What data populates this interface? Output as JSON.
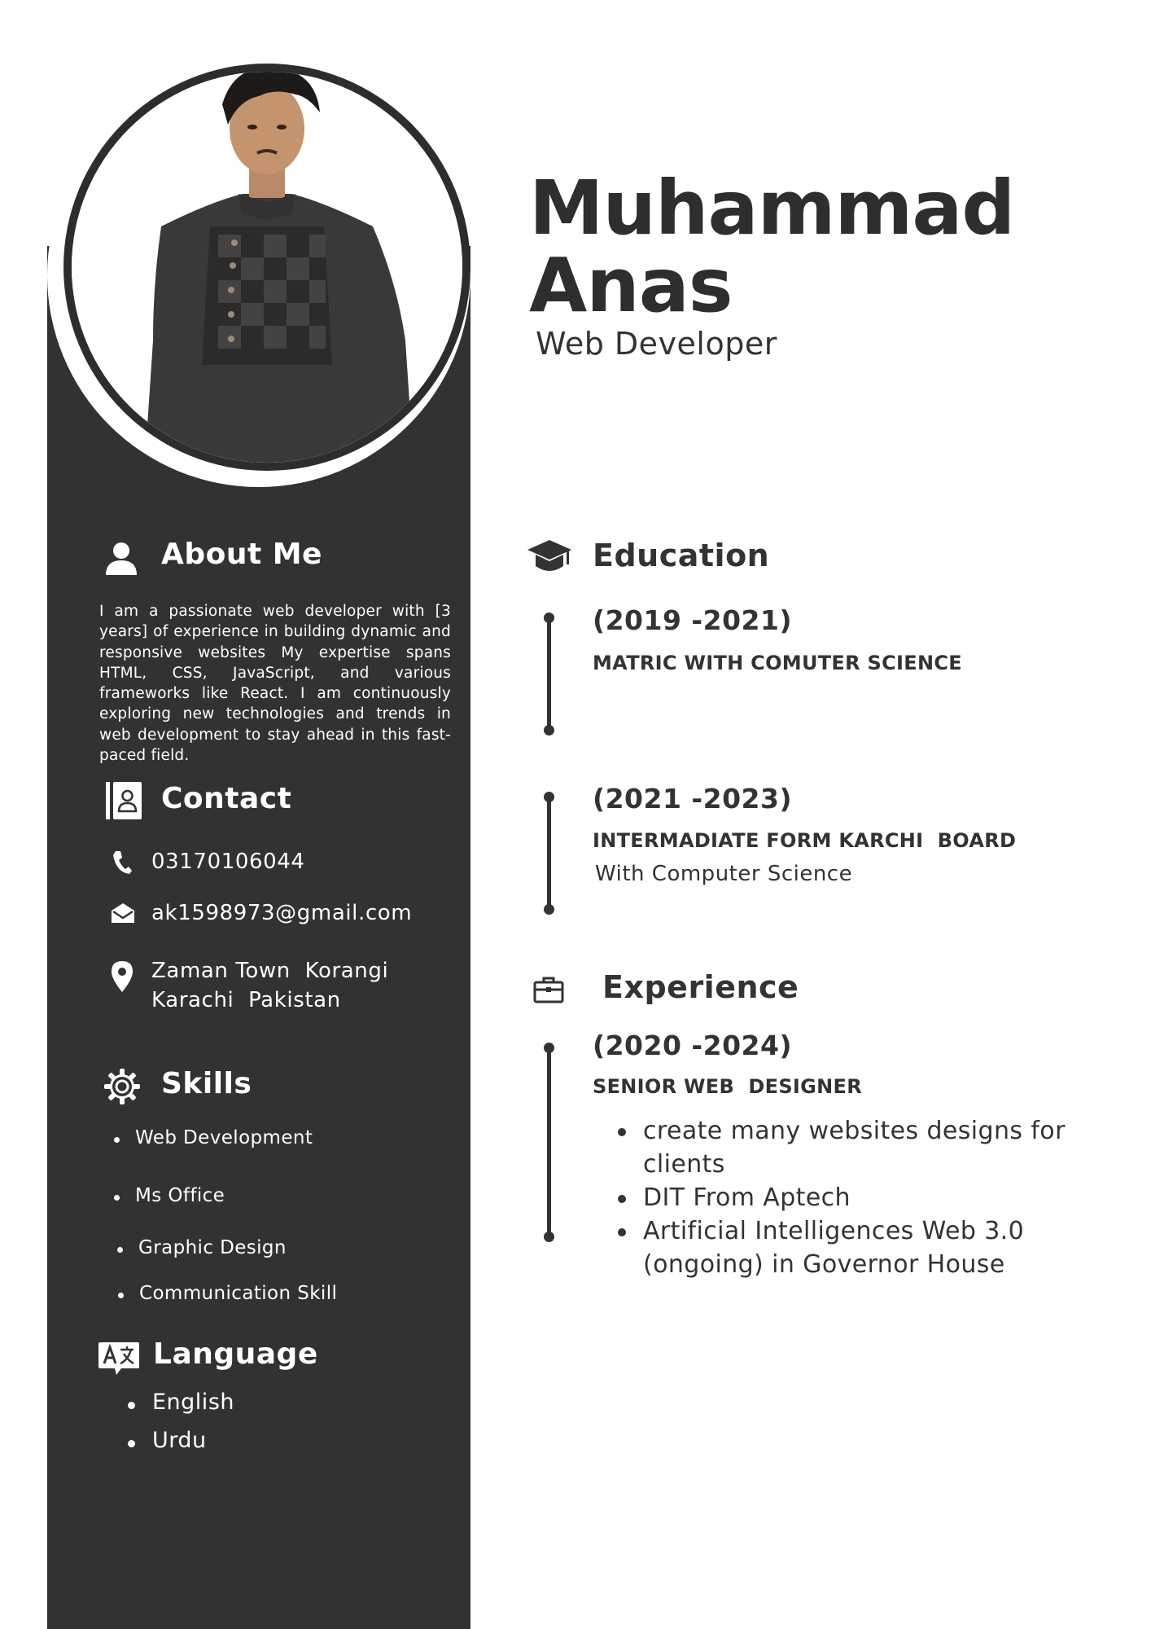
{
  "header": {
    "name_line1": "Muhammad",
    "name_line2": "Anas",
    "role": "Web Developer"
  },
  "about": {
    "heading": "About Me",
    "icon": "person-icon",
    "text": "I am a passionate web developer with [3 years] of experience in building dynamic and responsive websites My expertise spans HTML, CSS, JavaScript, and various frameworks like React. I am continuously exploring new technologies and trends in web development to stay ahead in this fast-paced field."
  },
  "contact": {
    "heading": "Contact",
    "icon": "contact-book-icon",
    "phone": "03170106044",
    "email": "ak1598973@gmail.com",
    "address_line1": "Zaman Town  Korangi",
    "address_line2": "Karachi  Pakistan"
  },
  "skills": {
    "heading": "Skills",
    "icon": "gear-icon",
    "items": [
      "Web Development",
      "Ms Office",
      "Graphic Design",
      "Communication Skill"
    ]
  },
  "language": {
    "heading": "Language",
    "icon": "translate-icon",
    "items": [
      "English",
      "Urdu"
    ]
  },
  "education": {
    "heading": "Education",
    "icon": "graduation-cap-icon",
    "entries": [
      {
        "years": "(2019 -2021)",
        "degree": "MATRIC WITH COMUTER SCIENCE",
        "detail": ""
      },
      {
        "years": "(2021 -2023)",
        "degree": "INTERMADIATE FORM KARCHI  BOARD",
        "detail": "With Computer Science"
      }
    ]
  },
  "experience": {
    "heading": "Experience",
    "icon": "briefcase-icon",
    "years": "(2020 -2024)",
    "title": "SENIOR WEB  DESIGNER",
    "bullets": [
      "create many websites designs for clients",
      "DIT From Aptech",
      "Artificial Intelligences Web 3.0 (ongoing) in Governor House"
    ]
  },
  "colors": {
    "sidebar": "#333233",
    "text_dark": "#333333",
    "background": "#ffffff"
  }
}
